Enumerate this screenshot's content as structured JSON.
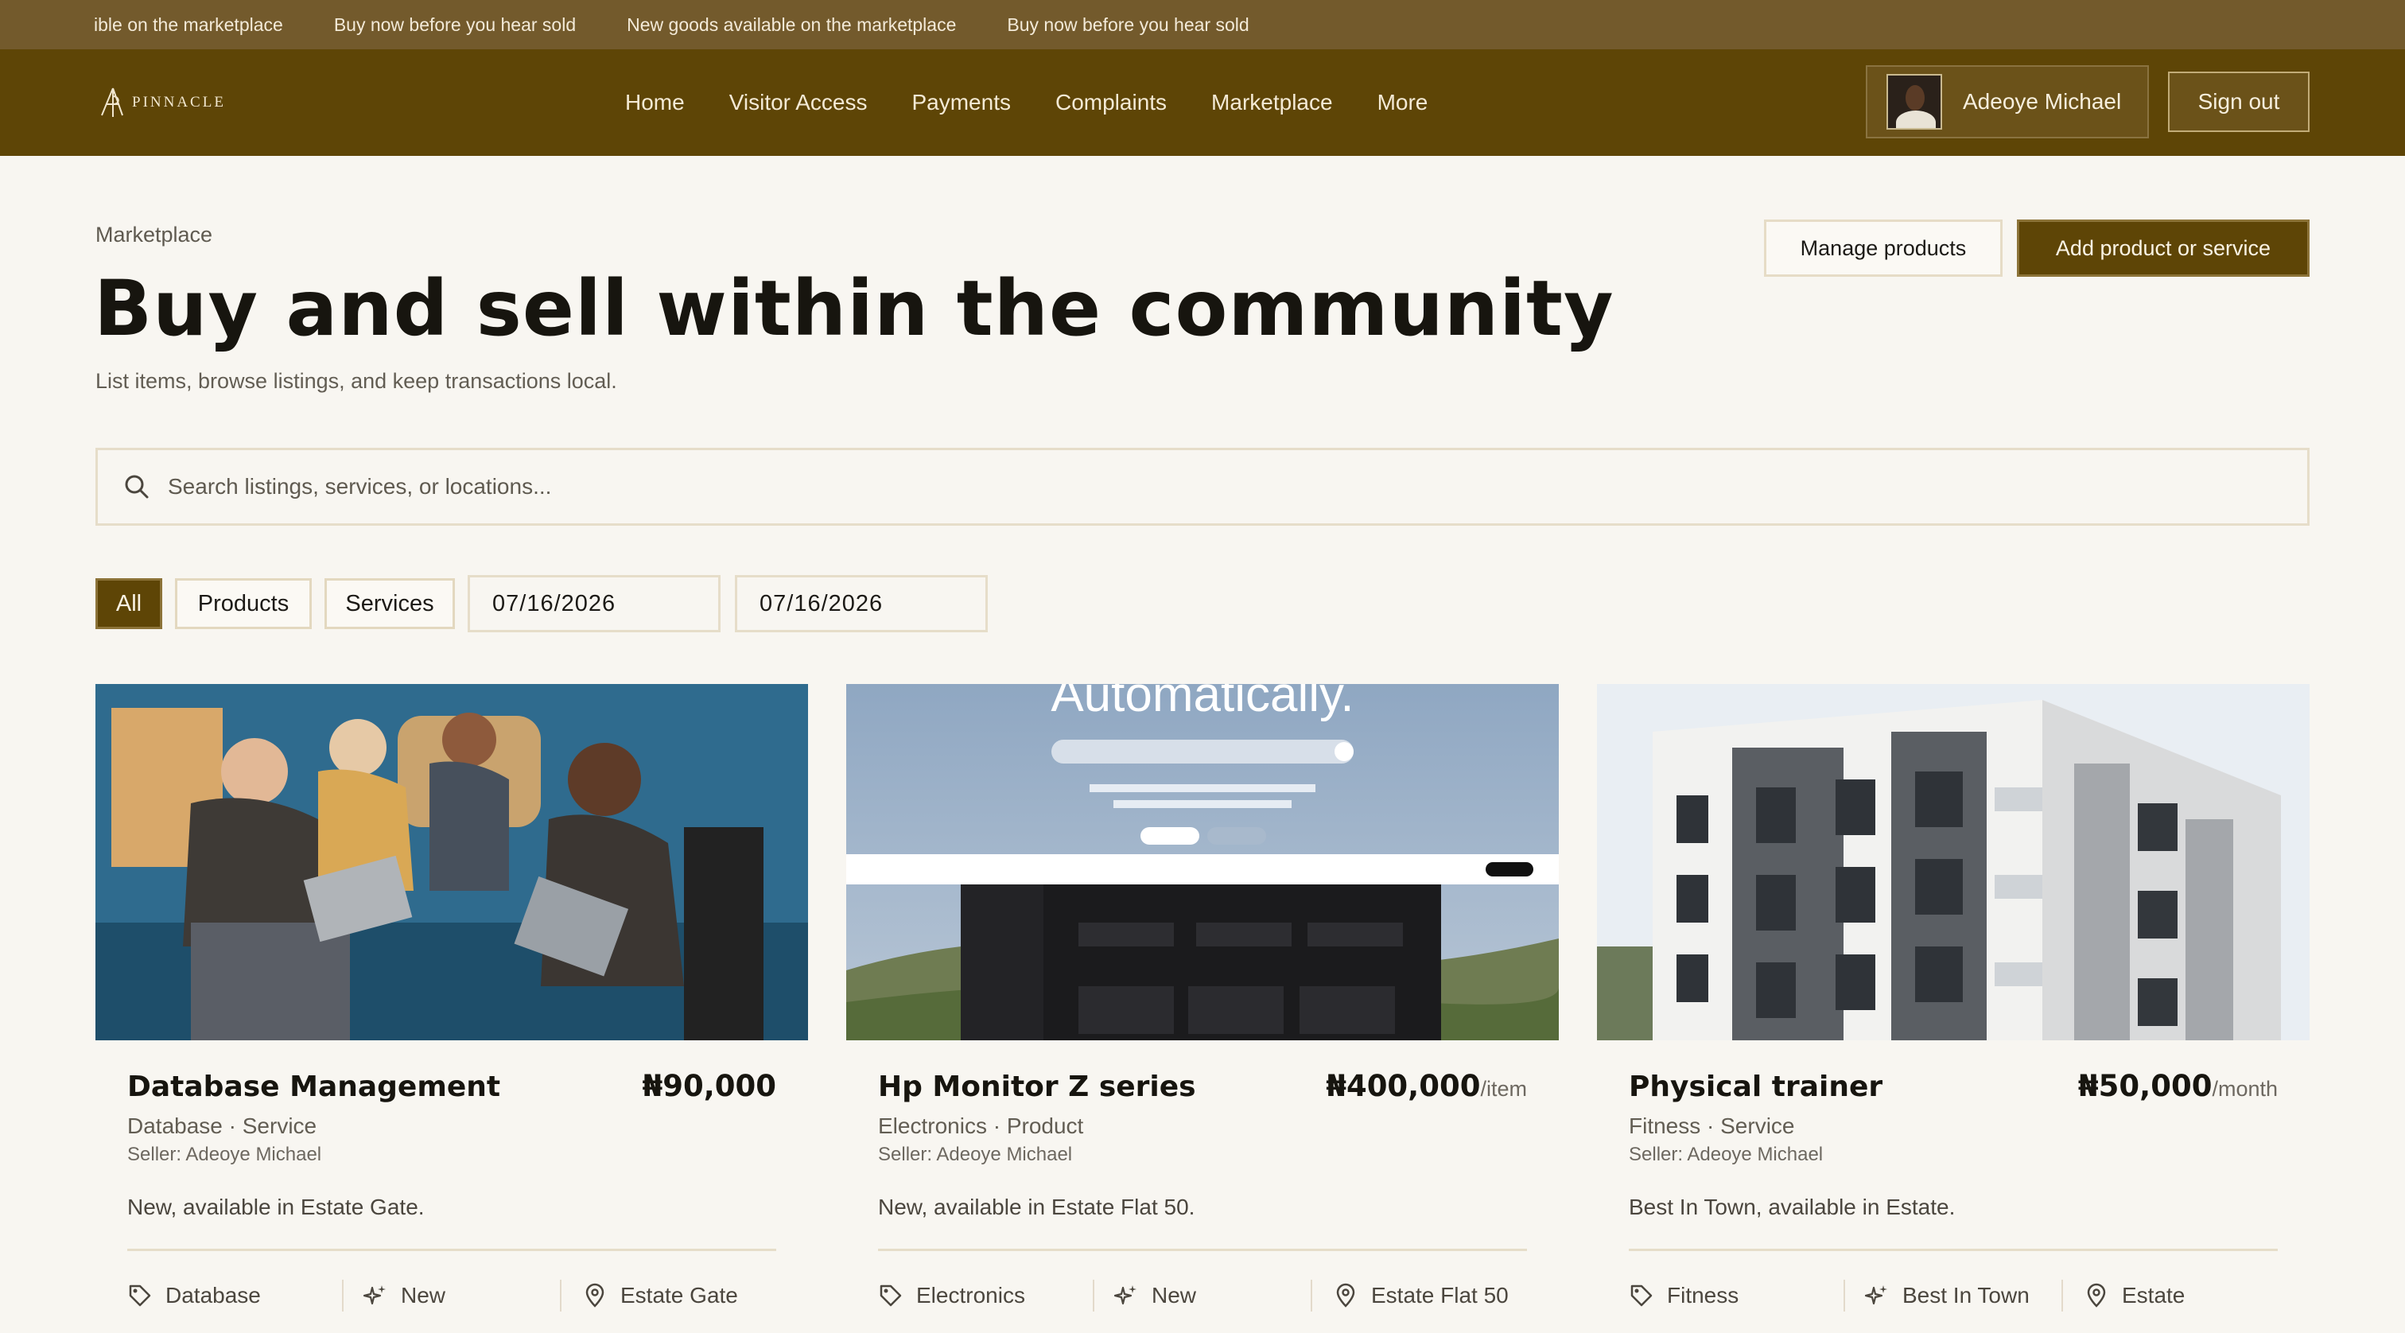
{
  "ticker": {
    "items": [
      "ible on the marketplace",
      "Buy now before you hear sold",
      "New goods available on the marketplace",
      "Buy now before you hear sold"
    ]
  },
  "nav": {
    "logo_text": "PINNACLE",
    "links": [
      "Home",
      "Visitor Access",
      "Payments",
      "Complaints",
      "Marketplace",
      "More"
    ],
    "user_name": "Adeoye Michael",
    "signout_label": "Sign out"
  },
  "header": {
    "breadcrumb": "Marketplace",
    "title": "Buy and sell within the community",
    "subtitle": "List items, browse listings, and keep transactions local.",
    "manage_label": "Manage products",
    "add_label": "Add product or service"
  },
  "search": {
    "placeholder": "Search listings, services, or locations..."
  },
  "filters": {
    "all": "All",
    "products": "Products",
    "services": "Services",
    "active": "All",
    "date_from": "07/16/2026",
    "date_to": "07/16/2026"
  },
  "listings": [
    {
      "title": "Database Management",
      "price": "₦90,000",
      "unit": "",
      "meta": "Database · Service",
      "seller": "Seller: Adeoye Michael",
      "description": "New, available in Estate Gate.",
      "tags": {
        "category": "Database",
        "condition": "New",
        "location": "Estate Gate"
      }
    },
    {
      "title": "Hp Monitor Z series",
      "price": "₦400,000",
      "unit": "/item",
      "meta": "Electronics · Product",
      "seller": "Seller: Adeoye Michael",
      "description": "New, available in Estate Flat 50.",
      "tags": {
        "category": "Electronics",
        "condition": "New",
        "location": "Estate Flat 50"
      },
      "image_text": "Automatically."
    },
    {
      "title": "Physical trainer",
      "price": "₦50,000",
      "unit": "/month",
      "meta": "Fitness · Service",
      "seller": "Seller: Adeoye Michael",
      "description": "Best In Town, available in Estate.",
      "tags": {
        "category": "Fitness",
        "condition": "Best In Town",
        "location": "Estate"
      }
    }
  ],
  "colors": {
    "brand": "#5e4506",
    "ticker": "#735a2c",
    "background": "#f8f6f1"
  }
}
